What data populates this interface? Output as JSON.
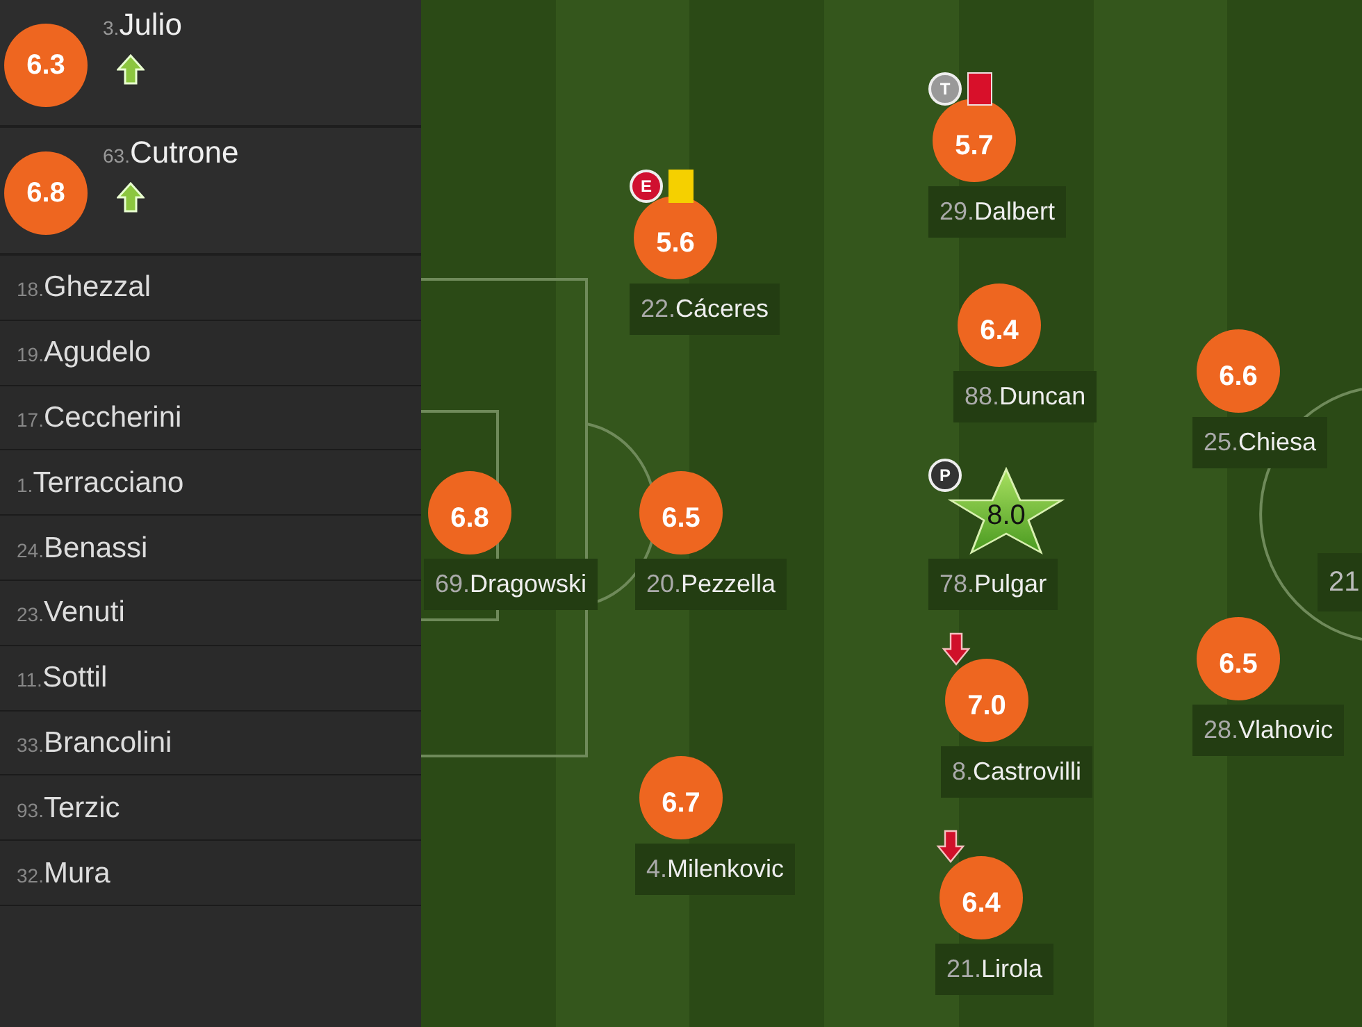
{
  "substitutes_in": [
    {
      "number": "3.",
      "name": "Julio",
      "rating": "6.3",
      "subbed_in": true
    },
    {
      "number": "63.",
      "name": "Cutrone",
      "rating": "6.8",
      "subbed_in": true
    }
  ],
  "bench": [
    {
      "number": "18.",
      "name": "Ghezzal"
    },
    {
      "number": "19.",
      "name": "Agudelo"
    },
    {
      "number": "17.",
      "name": "Ceccherini"
    },
    {
      "number": "1.",
      "name": "Terracciano"
    },
    {
      "number": "24.",
      "name": "Benassi"
    },
    {
      "number": "23.",
      "name": "Venuti"
    },
    {
      "number": "11.",
      "name": "Sottil"
    },
    {
      "number": "33.",
      "name": "Brancolini"
    },
    {
      "number": "93.",
      "name": "Terzic"
    },
    {
      "number": "32.",
      "name": "Mura"
    }
  ],
  "players": [
    {
      "number": "29.",
      "name": "Dalbert",
      "rating": "5.7",
      "kind": "circle",
      "event": "T",
      "yellow_card": false,
      "red_card": true,
      "subbed_off": false
    },
    {
      "number": "22.",
      "name": "Cáceres",
      "rating": "5.6",
      "kind": "circle",
      "event": "E",
      "yellow_card": true,
      "red_card": false,
      "subbed_off": false
    },
    {
      "number": "88.",
      "name": "Duncan",
      "rating": "6.4",
      "kind": "circle",
      "yellow_card": false,
      "red_card": false,
      "subbed_off": false
    },
    {
      "number": "25.",
      "name": "Chiesa",
      "rating": "6.6",
      "kind": "circle",
      "yellow_card": false,
      "red_card": false,
      "subbed_off": false
    },
    {
      "number": "69.",
      "name": "Dragowski",
      "rating": "6.8",
      "kind": "circle",
      "yellow_card": false,
      "red_card": false,
      "subbed_off": false
    },
    {
      "number": "20.",
      "name": "Pezzella",
      "rating": "6.5",
      "kind": "circle",
      "yellow_card": false,
      "red_card": false,
      "subbed_off": false
    },
    {
      "number": "78.",
      "name": "Pulgar",
      "rating": "8.0",
      "kind": "star",
      "event": "P",
      "yellow_card": false,
      "red_card": false,
      "subbed_off": false
    },
    {
      "number": "8.",
      "name": "Castrovilli",
      "rating": "7.0",
      "kind": "circle",
      "yellow_card": false,
      "red_card": false,
      "subbed_off": true
    },
    {
      "number": "28.",
      "name": "Vlahovic",
      "rating": "6.5",
      "kind": "circle",
      "yellow_card": false,
      "red_card": false,
      "subbed_off": false
    },
    {
      "number": "4.",
      "name": "Milenkovic",
      "rating": "6.7",
      "kind": "circle",
      "yellow_card": false,
      "red_card": false,
      "subbed_off": false
    },
    {
      "number": "21.",
      "name": "Lirola",
      "rating": "6.4",
      "kind": "circle",
      "yellow_card": false,
      "red_card": false,
      "subbed_off": true
    },
    {
      "number": "21",
      "kind": "label_only"
    }
  ]
}
